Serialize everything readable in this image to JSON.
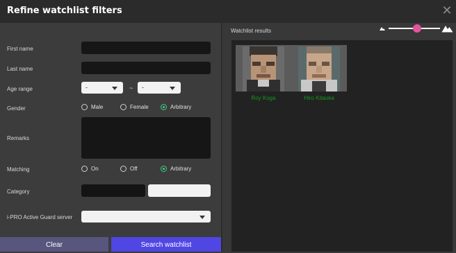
{
  "dialog": {
    "title": "Refine watchlist filters",
    "close_glyph": "✕"
  },
  "form": {
    "first_name": {
      "label": "First name",
      "value": ""
    },
    "last_name": {
      "label": "Last name",
      "value": ""
    },
    "age_range": {
      "label": "Age range",
      "from": "-",
      "to": "-",
      "separator": "~"
    },
    "gender": {
      "label": "Gender",
      "options": [
        "Male",
        "Female",
        "Arbitrary"
      ],
      "selected": "Arbitrary"
    },
    "remarks": {
      "label": "Remarks",
      "value": ""
    },
    "matching": {
      "label": "Matching",
      "options": [
        "On",
        "Off",
        "Arbitrary"
      ],
      "selected": "Arbitrary"
    },
    "category": {
      "label": "Category",
      "value": "",
      "second_value": ""
    },
    "server": {
      "label": "i-PRO Active Guard server",
      "value": ""
    }
  },
  "buttons": {
    "clear": "Clear",
    "search": "Search watchlist"
  },
  "results": {
    "title": "Watchlist results",
    "zoom_level": 0.55,
    "items": [
      {
        "name": "Roy Koga"
      },
      {
        "name": "Hiro Kitaoka"
      }
    ]
  },
  "colors": {
    "accent_green": "#3fd08a",
    "name_green": "#159a1e",
    "search_button": "#4f46e3",
    "clear_button": "#58557e",
    "zoom_knob": "#e2559c"
  },
  "icons": {
    "close": "close-icon",
    "caret": "chevron-down-icon",
    "zoom_out": "mountain-small-icon",
    "zoom_in": "mountain-large-icon"
  }
}
